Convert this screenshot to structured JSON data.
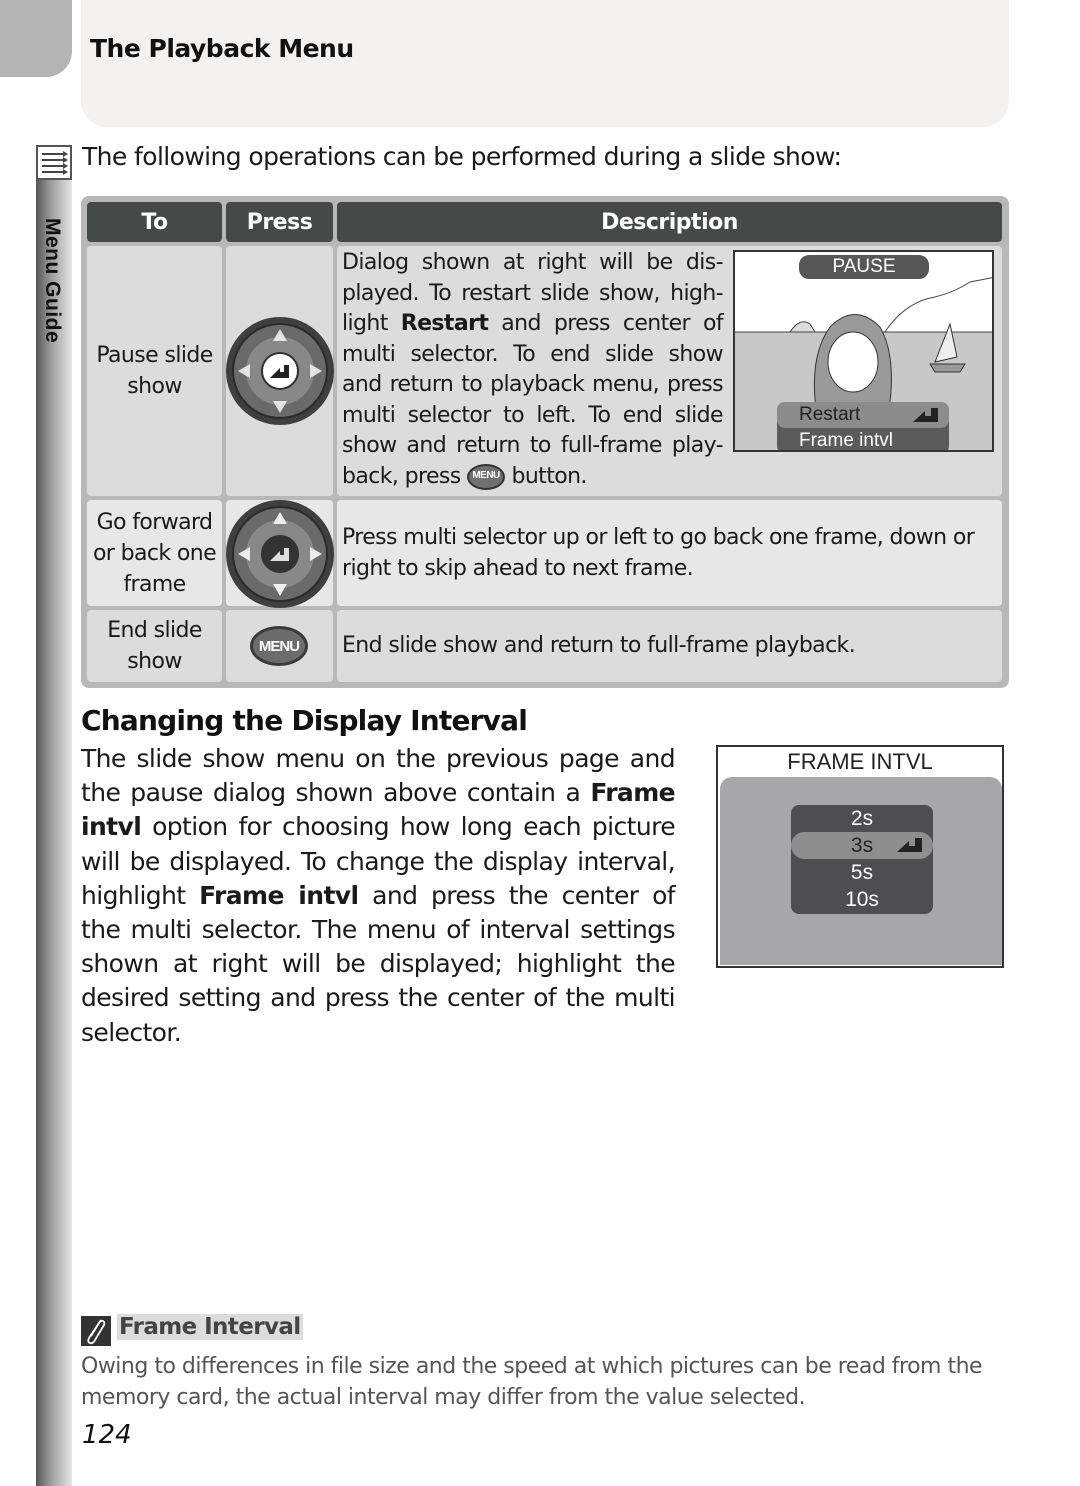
{
  "header": {
    "title": "The Playback Menu"
  },
  "side_tab": {
    "label": "Menu Guide",
    "icon": "menu-list-icon"
  },
  "intro": "The following operations can be performed during a slide show:",
  "table": {
    "columns": [
      "To",
      "Press",
      "Description"
    ],
    "rows": [
      {
        "to": "Pause slide show",
        "press_icon": "multi-selector-center-icon",
        "description_parts": {
          "p1": "Dialog shown at right will be dis-played.  To restart slide show, high-light ",
          "bold": "Restart",
          "p2": " and press center of multi selector.  To end slide show and return to playback menu, press multi selector to left.  To end slide show and return to full-frame play-back, press ",
          "button_label": "MENU",
          "p3": " button."
        },
        "dialog": {
          "badge": "PAUSE",
          "items": [
            {
              "label": "Restart",
              "selected": true
            },
            {
              "label": "Frame intvl",
              "selected": false
            }
          ]
        }
      },
      {
        "to": "Go forward or back one frame",
        "press_icon": "multi-selector-directions-icon",
        "description": "Press multi selector up or left to go back one frame, down or right to skip ahead to next frame."
      },
      {
        "to": "End slide show",
        "press_icon": "menu-button-icon",
        "press_label": "MENU",
        "description": "End slide show and return to full-frame playback."
      }
    ]
  },
  "section": {
    "title": "Changing the Display Interval",
    "body": {
      "p1": "The slide show menu on the previous page and the pause dialog shown above contain a ",
      "b1": "Frame intvl",
      "p2": " option for choosing how long each picture will be displayed.  To change the display interval, highlight ",
      "b2": "Frame intvl",
      "p3": " and press the center of the multi selector.  The menu of interval settings shown at right will be displayed; highlight the desired setting and press the center of the multi selector."
    },
    "interval_menu": {
      "title": "FRAME INTVL",
      "options": [
        "2s",
        "3s",
        "5s",
        "10s"
      ],
      "selected": "3s"
    }
  },
  "note": {
    "title": "Frame Interval",
    "body": "Owing to differences in file size and the speed at which pictures can be read from the memory card, the actual interval may differ from the value selected."
  },
  "page_number": "124"
}
